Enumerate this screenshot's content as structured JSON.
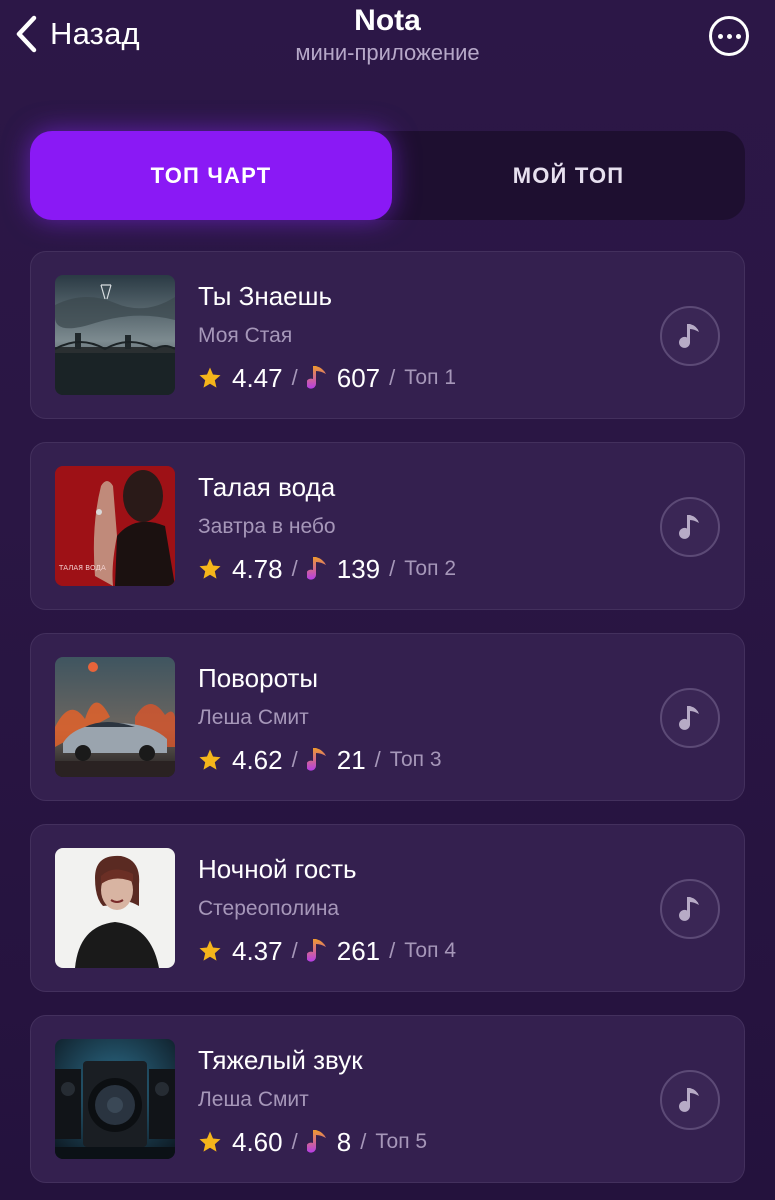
{
  "header": {
    "back_label": "Назад",
    "title": "Nota",
    "subtitle": "мини-приложение",
    "back_icon": "chevron-left-icon",
    "menu_icon": "more-dots-icon"
  },
  "tabs": [
    {
      "label": "ТОП ЧАРТ",
      "active": true
    },
    {
      "label": "МОЙ ТОП",
      "active": false
    }
  ],
  "colors": {
    "accent": "#8a19f5",
    "star": "#f5b51b",
    "note": "#c44de0",
    "background": "#2a1644",
    "card": "#34204f"
  },
  "tracks": [
    {
      "title": "Ты Знаешь",
      "artist": "Моя Стая",
      "rating": "4.47",
      "count": "607",
      "rank": "Топ 1"
    },
    {
      "title": "Талая вода",
      "artist": "Завтра в небо",
      "rating": "4.78",
      "count": "139",
      "rank": "Топ 2"
    },
    {
      "title": "Повороты",
      "artist": "Леша Смит",
      "rating": "4.62",
      "count": "21",
      "rank": "Топ 3"
    },
    {
      "title": "Ночной гость",
      "artist": "Стереополина",
      "rating": "4.37",
      "count": "261",
      "rank": "Топ 4"
    },
    {
      "title": "Тяжелый звук",
      "artist": "Леша Смит",
      "rating": "4.60",
      "count": "8",
      "rank": "Топ 5"
    }
  ],
  "cover_art": [
    "bridge-city-cover",
    "red-portrait-cover",
    "burning-car-cover",
    "woman-portrait-cover",
    "speaker-cover"
  ],
  "track_icons": {
    "rating": "star-icon",
    "plays": "music-note-icon",
    "action": "music-note-icon"
  }
}
